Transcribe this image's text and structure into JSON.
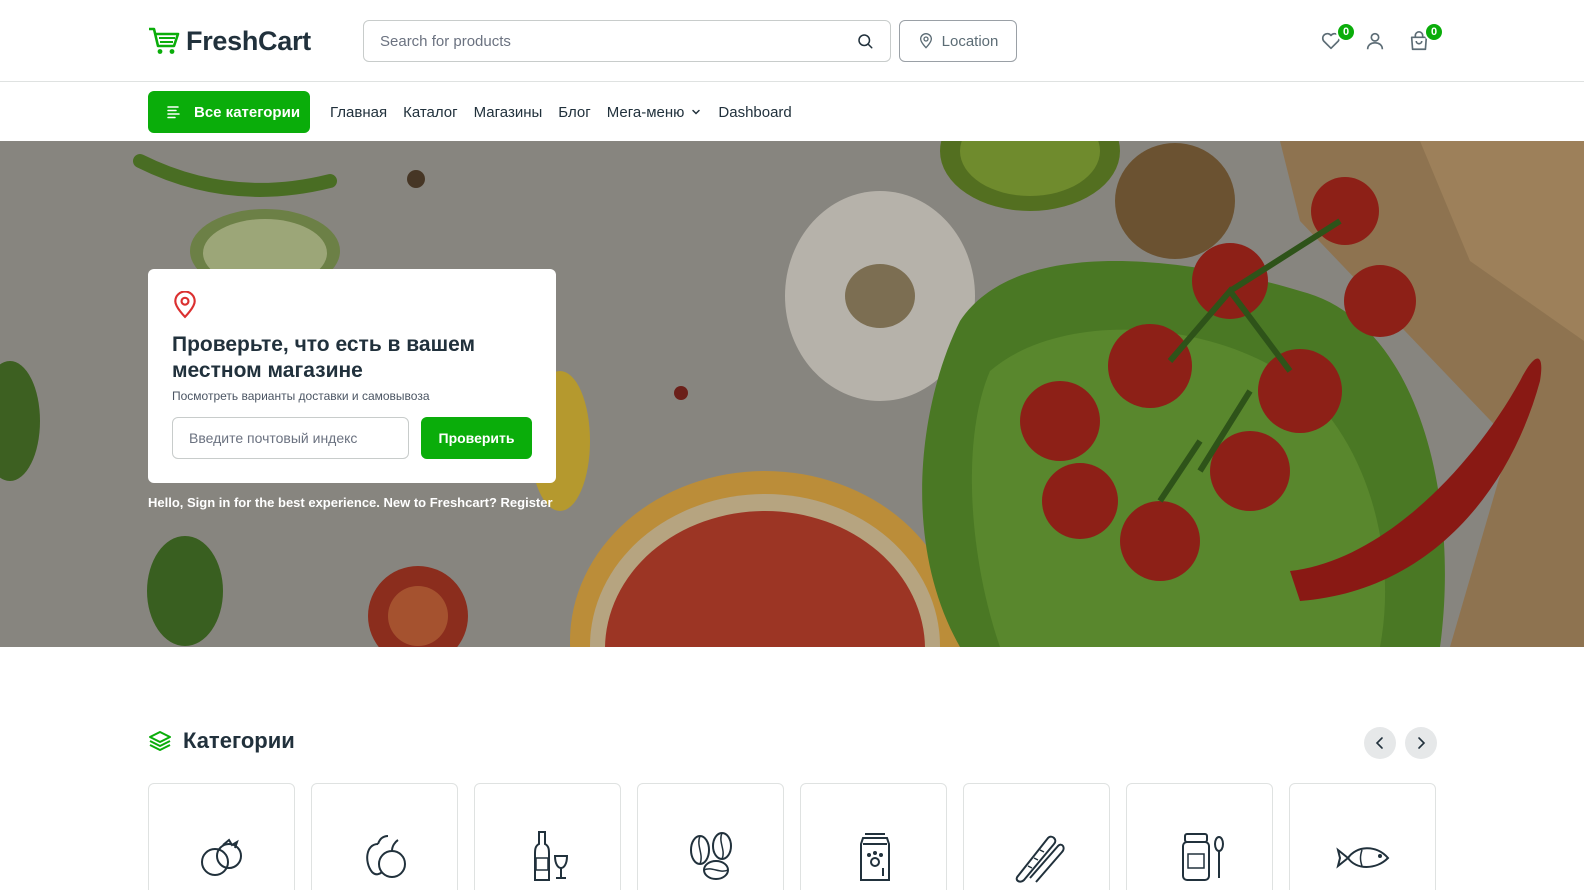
{
  "brand": {
    "name": "FreshCart",
    "accent": "#0aad0a",
    "icon": "cart-logo-icon"
  },
  "header": {
    "search_placeholder": "Search for products",
    "location_label": "Location",
    "wishlist_count": "0",
    "cart_count": "0"
  },
  "nav": {
    "all_categories": "Все категории",
    "links": [
      "Главная",
      "Каталог",
      "Магазины",
      "Блог",
      "Мега-меню",
      "Dashboard"
    ]
  },
  "hero": {
    "title": "Проверьте, что есть в вашем местном магазине",
    "subtitle": "Посмотреть варианты доставки и самовывоза",
    "zip_placeholder": "Введите почтовый индекс",
    "check_button": "Проверить",
    "signin_text": "Hello, Sign in for the best experience. New to Freshcart? Register"
  },
  "categories": {
    "title": "Категории",
    "items": [
      "vegetables-icon",
      "fruits-icon",
      "wine-icon",
      "coffee-beans-icon",
      "pet-food-icon",
      "bread-icon",
      "jam-icon",
      "fish-icon"
    ]
  }
}
